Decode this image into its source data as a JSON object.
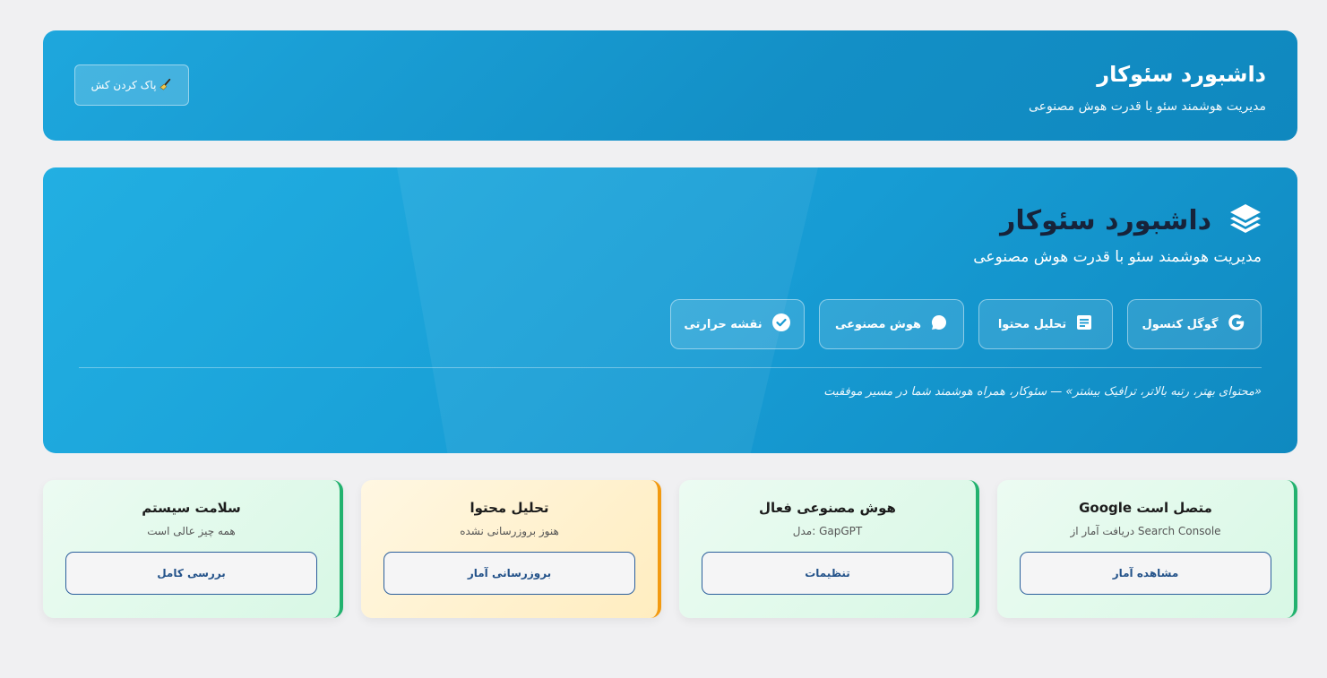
{
  "header": {
    "title": "داشبورد سئوکار",
    "subtitle": "مدیریت هوشمند سئو با قدرت هوش مصنوعی",
    "clear_cache_label": "پاک کردن کش",
    "clear_cache_icon": "broom-icon"
  },
  "hero": {
    "title": "داشبورد سئوکار",
    "title_icon": "layers-icon",
    "subtitle": "مدیریت هوشمند سئو با قدرت هوش مصنوعی",
    "buttons": [
      {
        "label": "گوگل کنسول",
        "icon": "google-icon"
      },
      {
        "label": "تحلیل محتوا",
        "icon": "document-icon"
      },
      {
        "label": "هوش مصنوعی",
        "icon": "chat-bubble-icon"
      },
      {
        "label": "نقشه حرارتی",
        "icon": "check-circle-icon"
      }
    ],
    "quote": "«محتوای بهتر، رتبه بالاتر، ترافیک بیشتر» — سئوکار، همراه هوشمند شما در مسیر موفقیت"
  },
  "cards": [
    {
      "title": "Google متصل است",
      "description": "دریافت آمار از Search Console",
      "button": "مشاهده آمار",
      "status_color": "#23b26f"
    },
    {
      "title": "هوش مصنوعی فعال",
      "description": "مدل: GapGPT",
      "button": "تنظیمات",
      "status_color": "#23b26f"
    },
    {
      "title": "تحلیل محتوا",
      "description": "هنوز بروزرسانی نشده",
      "button": "بروزرسانی آمار",
      "status_color": "#f29a11"
    },
    {
      "title": "سلامت سیستم",
      "description": "همه چیز عالی است",
      "button": "بررسی کامل",
      "status_color": "#23b26f"
    }
  ],
  "colors": {
    "brand_blue": "#1ea7dd",
    "success_green": "#23b26f",
    "warning_orange": "#f29a11",
    "button_text_blue": "#24538a"
  }
}
